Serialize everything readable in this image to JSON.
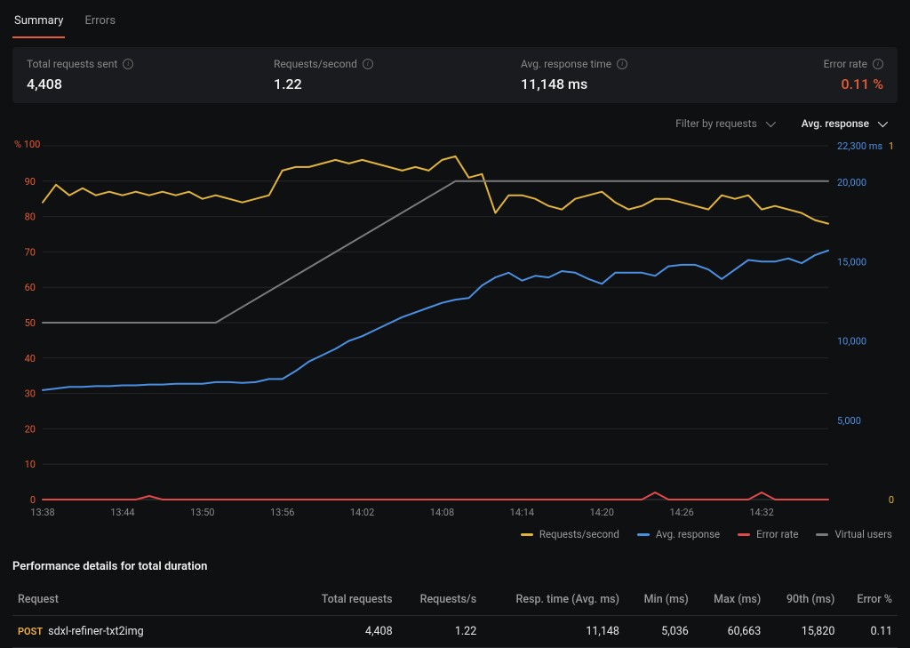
{
  "tabs": {
    "summary": "Summary",
    "errors": "Errors"
  },
  "stats": {
    "total_requests": {
      "label": "Total requests sent",
      "value": "4,408"
    },
    "rps": {
      "label": "Requests/second",
      "value": "1.22"
    },
    "avg_resp": {
      "label": "Avg. response time",
      "value": "11,148 ms"
    },
    "error_rate": {
      "label": "Error rate",
      "value": "0.11 %"
    }
  },
  "controls": {
    "filter_label": "Filter by requests",
    "metric_label": "Avg. response"
  },
  "legend": {
    "rps": "Requests/second",
    "avg": "Avg. response",
    "err": "Error rate",
    "vu": "Virtual users"
  },
  "perf_section_title": "Performance details for total duration",
  "perf_headers": {
    "request": "Request",
    "total": "Total requests",
    "rps": "Requests/s",
    "resp": "Resp. time (Avg. ms)",
    "min": "Min (ms)",
    "max": "Max (ms)",
    "p90": "90th (ms)",
    "err": "Error %"
  },
  "perf_rows": [
    {
      "method": "POST",
      "name": "sdxl-refiner-txt2img",
      "total": "4,408",
      "rps": "1.22",
      "resp": "11,148",
      "min": "5,036",
      "max": "60,663",
      "p90": "15,820",
      "err": "0.11"
    }
  ],
  "chart_data": {
    "type": "line",
    "x_ticks": [
      "13:38",
      "13:44",
      "13:50",
      "13:56",
      "14:02",
      "14:08",
      "14:14",
      "14:20",
      "14:26",
      "14:32"
    ],
    "left_axis": {
      "label": "%",
      "min": 0,
      "max": 100,
      "ticks": [
        0,
        10,
        20,
        30,
        40,
        50,
        60,
        70,
        80,
        90,
        100
      ],
      "color": "#e85c33"
    },
    "right_axis_a": {
      "label": "ms",
      "min": 0,
      "max": 22300,
      "ticks": [
        5000,
        10000,
        15000,
        20000,
        22300
      ],
      "tick_labels": [
        "5,000",
        "10,000",
        "15,000",
        "20,000",
        "22,300 ms"
      ],
      "color": "#4a90e2"
    },
    "right_axis_b": {
      "min": 0,
      "max": 1,
      "ticks": [
        0,
        1
      ],
      "color": "#e2b43a"
    },
    "series": [
      {
        "name": "Requests/second",
        "axis": "left",
        "color": "#e2b43a",
        "x": [
          "13:38",
          "13:39",
          "13:40",
          "13:41",
          "13:42",
          "13:43",
          "13:44",
          "13:45",
          "13:46",
          "13:47",
          "13:48",
          "13:49",
          "13:50",
          "13:51",
          "13:52",
          "13:53",
          "13:54",
          "13:55",
          "13:56",
          "13:57",
          "13:58",
          "13:59",
          "14:00",
          "14:01",
          "14:02",
          "14:03",
          "14:04",
          "14:05",
          "14:06",
          "14:07",
          "14:08",
          "14:09",
          "14:10",
          "14:11",
          "14:12",
          "14:13",
          "14:14",
          "14:15",
          "14:16",
          "14:17",
          "14:18",
          "14:19",
          "14:20",
          "14:21",
          "14:22",
          "14:23",
          "14:24",
          "14:25",
          "14:26",
          "14:27",
          "14:28",
          "14:29",
          "14:30",
          "14:31",
          "14:32",
          "14:33",
          "14:34",
          "14:35",
          "14:36",
          "14:37"
        ],
        "values": [
          84,
          89,
          86,
          88,
          86,
          87,
          86,
          87,
          86,
          87,
          86,
          87,
          85,
          86,
          85,
          84,
          85,
          86,
          93,
          94,
          94,
          95,
          96,
          95,
          96,
          95,
          94,
          93,
          94,
          93,
          96,
          97,
          91,
          92,
          81,
          86,
          86,
          85,
          83,
          82,
          85,
          86,
          87,
          84,
          82,
          83,
          85,
          85,
          84,
          83,
          82,
          86,
          85,
          86,
          82,
          83,
          82,
          81,
          79,
          78
        ]
      },
      {
        "name": "Avg. response",
        "axis": "right_a",
        "color": "#4a90e2",
        "x": [
          "13:38",
          "13:39",
          "13:40",
          "13:41",
          "13:42",
          "13:43",
          "13:44",
          "13:45",
          "13:46",
          "13:47",
          "13:48",
          "13:49",
          "13:50",
          "13:51",
          "13:52",
          "13:53",
          "13:54",
          "13:55",
          "13:56",
          "13:57",
          "13:58",
          "13:59",
          "14:00",
          "14:01",
          "14:02",
          "14:03",
          "14:04",
          "14:05",
          "14:06",
          "14:07",
          "14:08",
          "14:09",
          "14:10",
          "14:11",
          "14:12",
          "14:13",
          "14:14",
          "14:15",
          "14:16",
          "14:17",
          "14:18",
          "14:19",
          "14:20",
          "14:21",
          "14:22",
          "14:23",
          "14:24",
          "14:25",
          "14:26",
          "14:27",
          "14:28",
          "14:29",
          "14:30",
          "14:31",
          "14:32",
          "14:33",
          "14:34",
          "14:35",
          "14:36",
          "14:37"
        ],
        "values": [
          6900,
          7000,
          7100,
          7100,
          7150,
          7150,
          7200,
          7200,
          7250,
          7250,
          7300,
          7300,
          7300,
          7400,
          7400,
          7350,
          7400,
          7600,
          7600,
          8100,
          8700,
          9100,
          9500,
          10000,
          10300,
          10700,
          11100,
          11500,
          11800,
          12100,
          12400,
          12600,
          12700,
          13500,
          14000,
          14300,
          13800,
          14100,
          14000,
          14400,
          14300,
          13900,
          13600,
          14300,
          14300,
          14300,
          14100,
          14700,
          14800,
          14800,
          14500,
          13900,
          14500,
          15100,
          15000,
          15000,
          15200,
          14900,
          15400,
          15700
        ]
      },
      {
        "name": "Error rate",
        "axis": "left",
        "color": "#e24a4a",
        "x": [
          "13:38",
          "13:39",
          "13:40",
          "13:41",
          "13:42",
          "13:43",
          "13:44",
          "13:45",
          "13:46",
          "13:47",
          "13:48",
          "13:49",
          "13:50",
          "13:51",
          "13:52",
          "13:53",
          "13:54",
          "13:55",
          "13:56",
          "13:57",
          "13:58",
          "13:59",
          "14:00",
          "14:01",
          "14:02",
          "14:03",
          "14:04",
          "14:05",
          "14:06",
          "14:07",
          "14:08",
          "14:09",
          "14:10",
          "14:11",
          "14:12",
          "14:13",
          "14:14",
          "14:15",
          "14:16",
          "14:17",
          "14:18",
          "14:19",
          "14:20",
          "14:21",
          "14:22",
          "14:23",
          "14:24",
          "14:25",
          "14:26",
          "14:27",
          "14:28",
          "14:29",
          "14:30",
          "14:31",
          "14:32",
          "14:33",
          "14:34",
          "14:35",
          "14:36",
          "14:37"
        ],
        "values": [
          0,
          0,
          0,
          0,
          0,
          0,
          0,
          0,
          1,
          0,
          0,
          0,
          0,
          0,
          0,
          0,
          0,
          0,
          0,
          0,
          0,
          0,
          0,
          0,
          0,
          0,
          0,
          0,
          0,
          0,
          0,
          0,
          0,
          0,
          0,
          0,
          0,
          0,
          0,
          0,
          0,
          0,
          0,
          0,
          0,
          0,
          2,
          0,
          0,
          0,
          0,
          0,
          0,
          0,
          2,
          0,
          0,
          0,
          0,
          0
        ]
      },
      {
        "name": "Virtual users",
        "axis": "right_b",
        "color": "#7a7a7a",
        "x": [
          "13:38",
          "13:51",
          "14:09",
          "14:37"
        ],
        "values": [
          0.5,
          0.5,
          0.9,
          0.9
        ]
      }
    ]
  }
}
